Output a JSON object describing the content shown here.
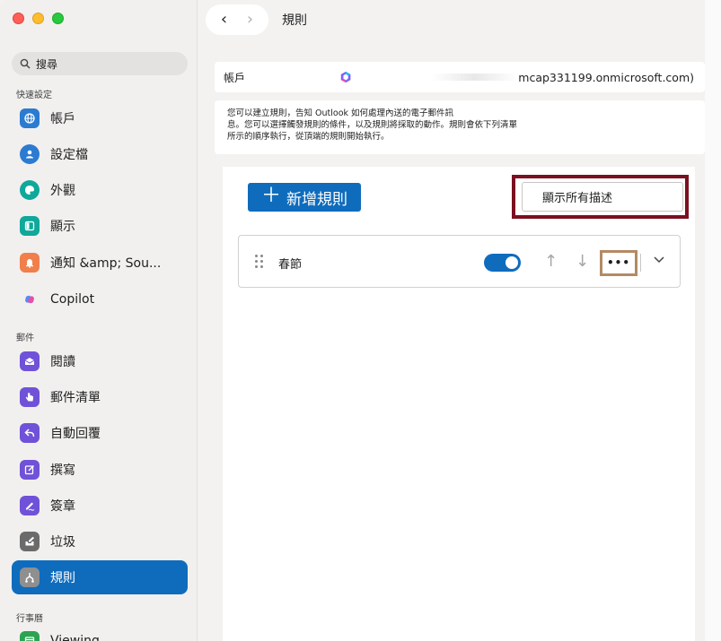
{
  "window": {
    "title": "規則"
  },
  "sidebar": {
    "search_label": "搜尋",
    "sections": {
      "quick_settings": "快速設定",
      "mail": "郵件",
      "calendar": "行事曆"
    },
    "items": [
      {
        "label": "帳戶",
        "icon": "globe-icon",
        "color": "#2b7bd1"
      },
      {
        "label": "設定檔",
        "icon": "person-icon",
        "color": "#2b7bd1"
      },
      {
        "label": "外觀",
        "icon": "palette-icon",
        "color": "#0fa89a"
      },
      {
        "label": "顯示",
        "icon": "layout-icon",
        "color": "#0fa89a"
      },
      {
        "label": "通知 &amp; Sou...",
        "icon": "bell-icon",
        "color": "#f07f4c"
      },
      {
        "label": "Copilot",
        "icon": "copilot-icon",
        "color": "#8a5cf6"
      },
      {
        "label": "閱讀",
        "icon": "envelope-open-icon",
        "color": "#6f52d8"
      },
      {
        "label": "郵件清單",
        "icon": "list-hand-icon",
        "color": "#6f52d8"
      },
      {
        "label": "自動回覆",
        "icon": "reply-icon",
        "color": "#6f52d8"
      },
      {
        "label": "撰寫",
        "icon": "compose-icon",
        "color": "#6f52d8"
      },
      {
        "label": "簽章",
        "icon": "signature-icon",
        "color": "#6f52d8"
      },
      {
        "label": "垃圾",
        "icon": "junk-icon",
        "color": "#6f52d8"
      },
      {
        "label": "規則",
        "icon": "rules-icon",
        "color": "#6f52d8"
      },
      {
        "label": "Viewing",
        "icon": "calendar-icon",
        "color": "#2aa44f"
      }
    ]
  },
  "topbar": {
    "back_label": "‹",
    "forward_label": "›"
  },
  "account": {
    "label": "帳戶",
    "email": "mcap331199.onmicrosoft.com)"
  },
  "description": {
    "line1": "您可以建立規則，告知 Outlook 如何處理內送的電子郵件訊",
    "line2": "息。您可以選擇觸發規則的條件，以及規則將採取的動作。規則會依下列清單",
    "line3": "所示的順序執行，從頂端的規則開始執行。"
  },
  "rules": {
    "add_label": "新增規則",
    "show_descriptions_label": "顯示所有描述",
    "list": [
      {
        "name": "春節",
        "enabled": true,
        "more_label": "•••"
      }
    ]
  },
  "colors": {
    "accent": "#0f6cbd",
    "highlight_frame_1": "#7b1020",
    "highlight_frame_2": "#b48a64"
  }
}
